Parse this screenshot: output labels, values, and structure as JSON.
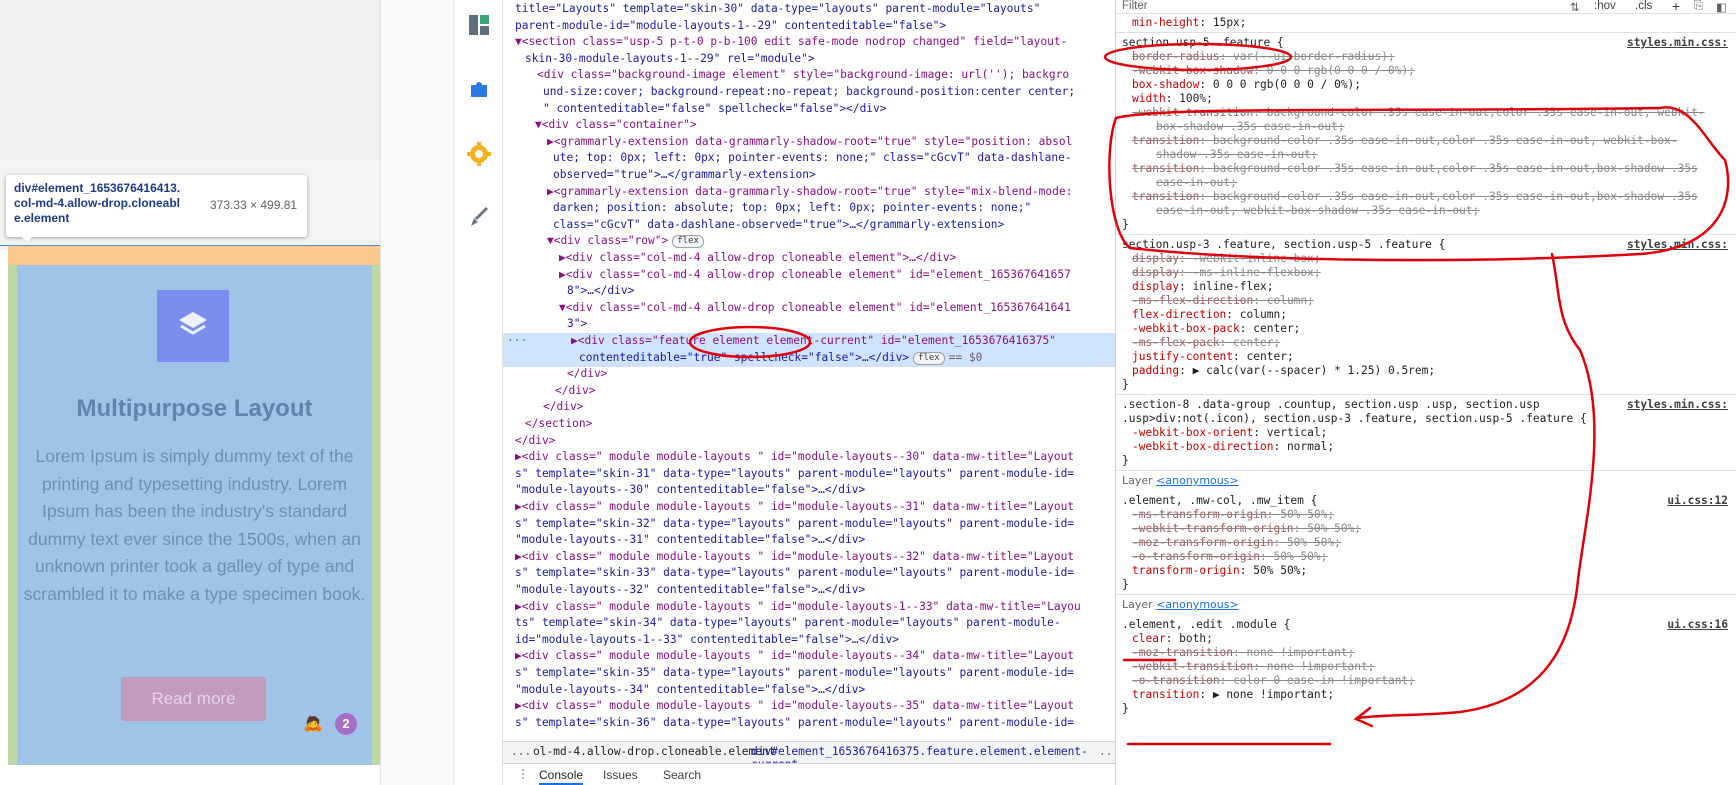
{
  "tooltip": {
    "selector": "div#element_1653676416413.",
    "classes_line1": "col-md-4.allow-drop.cloneabl",
    "classes_line2": "e.element",
    "size": "373.33 × 499.81"
  },
  "feature_card": {
    "title": "Multipurpose Layout",
    "body": "Lorem Ipsum is simply dummy text of the printing and typesetting industry. Lorem Ipsum has been the industry's standard dummy text ever since the 1500s, when an unknown printer took a galley of type and scrambled it to make a type specimen book.",
    "button": "Read more",
    "notif_count": "2"
  },
  "sidebar_icons": [
    "layout-icon",
    "puzzle-icon",
    "settings-gear-icon",
    "brush-icon"
  ],
  "dom_lines": [
    {
      "t": "title=\"Layouts\" template=\"skin-30\" data-type=\"layouts\" parent-module=\"layouts\""
    },
    {
      "t": "parent-module-id=\"module-layouts-1--29\" contenteditable=\"false\">"
    },
    {
      "t": "▼<section class=\"usp-5 p-t-0 p-b-100 edit safe-mode nodrop changed\" field=\"layout-"
    },
    {
      "t": "skin-30-module-layouts-1--29\" rel=\"module\">"
    },
    {
      "t": "<div class=\"background-image element\" style=\"background-image: url(''); backgro"
    },
    {
      "t": "und-size:cover; background-repeat:no-repeat; background-position:center center;"
    },
    {
      "t": "\" contenteditable=\"false\" spellcheck=\"false\"></div>"
    },
    {
      "t": "▼<div class=\"container\">"
    },
    {
      "t": "▶<grammarly-extension data-grammarly-shadow-root=\"true\" style=\"position: absol"
    },
    {
      "t": "ute; top: 0px; left: 0px; pointer-events: none;\" class=\"cGcvT\" data-dashlane-"
    },
    {
      "t": "observed=\"true\">…</grammarly-extension>"
    },
    {
      "t": "▶<grammarly-extension data-grammarly-shadow-root=\"true\" style=\"mix-blend-mode:"
    },
    {
      "t": "darken; position: absolute; top: 0px; left: 0px; pointer-events: none;\""
    },
    {
      "t": "class=\"cGcvT\" data-dashlane-observed=\"true\">…</grammarly-extension>"
    },
    {
      "t": "▼<div class=\"row\">",
      "badge": "flex"
    },
    {
      "t": "▶<div class=\"col-md-4 allow-drop cloneable element\">…</div>"
    },
    {
      "t": "▶<div class=\"col-md-4 allow-drop cloneable element\" id=\"element_165367641657"
    },
    {
      "t": "8\">…</div>"
    },
    {
      "t": "▼<div class=\"col-md-4 allow-drop cloneable element\" id=\"element_165367641641"
    },
    {
      "t": "3\">"
    },
    {
      "t": "▶<div class=\"feature element element-current\" id=\"element_1653676416375\""
    },
    {
      "t": "contenteditable=\"true\" spellcheck=\"false\">…</div>",
      "badge": "flex",
      "tail": "== $0"
    },
    {
      "t": "</div>"
    },
    {
      "t": "</div>"
    },
    {
      "t": "</div>"
    },
    {
      "t": "</section>"
    },
    {
      "t": "</div>"
    },
    {
      "t": "▶<div class=\" module module-layouts \" id=\"module-layouts--30\" data-mw-title=\"Layout"
    },
    {
      "t": "s\" template=\"skin-31\" data-type=\"layouts\" parent-module=\"layouts\" parent-module-id="
    },
    {
      "t": "\"module-layouts--30\" contenteditable=\"false\">…</div>"
    },
    {
      "t": "▶<div class=\" module module-layouts \" id=\"module-layouts--31\" data-mw-title=\"Layout"
    },
    {
      "t": "s\" template=\"skin-32\" data-type=\"layouts\" parent-module=\"layouts\" parent-module-id="
    },
    {
      "t": "\"module-layouts--31\" contenteditable=\"false\">…</div>"
    },
    {
      "t": "▶<div class=\" module module-layouts \" id=\"module-layouts--32\" data-mw-title=\"Layout"
    },
    {
      "t": "s\" template=\"skin-33\" data-type=\"layouts\" parent-module=\"layouts\" parent-module-id="
    },
    {
      "t": "\"module-layouts--32\" contenteditable=\"false\">…</div>"
    },
    {
      "t": "▶<div class=\" module module-layouts \" id=\"module-layouts-1--33\" data-mw-title=\"Layou"
    },
    {
      "t": "ts\" template=\"skin-34\" data-type=\"layouts\" parent-module=\"layouts\" parent-module-"
    },
    {
      "t": "id=\"module-layouts-1--33\" contenteditable=\"false\">…</div>"
    },
    {
      "t": "▶<div class=\" module module-layouts \" id=\"module-layouts--34\" data-mw-title=\"Layout"
    },
    {
      "t": "s\" template=\"skin-35\" data-type=\"layouts\" parent-module=\"layouts\" parent-module-id="
    },
    {
      "t": "\"module-layouts--34\" contenteditable=\"false\">…</div>"
    },
    {
      "t": "▶<div class=\" module module-layouts \" id=\"module-layouts--35\" data-mw-title=\"Layout"
    },
    {
      "t": "s\" template=\"skin-36\" data-type=\"layouts\" parent-module=\"layouts\" parent-module-id="
    }
  ],
  "breadcrumbs": [
    "...",
    "ol-md-4.allow-drop.cloneable.element",
    "div#element_1653676416375.feature.element.element-current",
    "..."
  ],
  "drawer_tabs": [
    "Console",
    "Issues",
    "Search"
  ],
  "styles": {
    "filter_placeholder": "Filter",
    "toolbar": [
      ":hov",
      ".cls",
      "+"
    ],
    "rules": [
      {
        "selector": "",
        "link": "",
        "props": [
          {
            "n": "min-height",
            "v": "15px;"
          }
        ]
      },
      {
        "selector": "section.usp-5 .feature {",
        "link": "styles.min.css:",
        "props": [
          {
            "n": "border-radius",
            "v": "var(--ui-border-radius);",
            "s": true
          },
          {
            "n": "-webkit-box-shadow",
            "v": "0 0 0 rgb(0 0 0 / 0%);",
            "s": true
          },
          {
            "n": "box-shadow",
            "v": "0 0 0 rgb(0 0 0 / 0%);"
          },
          {
            "n": "width",
            "v": "100%;"
          },
          {
            "n": "-webkit-transition",
            "v": "background-color .35s ease-in-out,color .35s ease-in-out, webkit-",
            "s": true
          },
          {
            "n": "",
            "v": "box-shadow .35s ease-in-out;",
            "s": true,
            "i": true
          },
          {
            "n": "transition",
            "v": "background-color .35s ease-in-out,color .35s ease-in-out, webkit-box-",
            "s": true
          },
          {
            "n": "",
            "v": "shadow .35s ease-in-out;",
            "s": true,
            "i": true
          },
          {
            "n": "transition",
            "v": "background-color .35s ease-in-out,color .35s ease-in-out,box-shadow .35s",
            "s": true
          },
          {
            "n": "",
            "v": "ease-in-out;",
            "s": true,
            "i": true
          },
          {
            "n": "transition",
            "v": "background-color .35s ease-in-out,color .35s ease-in-out,box-shadow .35s",
            "s": true
          },
          {
            "n": "",
            "v": "ease-in-out, webkit-box-shadow .35s ease-in-out;",
            "s": true,
            "i": true
          }
        ]
      },
      {
        "selector": "section.usp-3 .feature, section.usp-5 .feature {",
        "link": "styles.min.css:",
        "props": [
          {
            "n": "display",
            "v": "-webkit-inline-box;",
            "s": true
          },
          {
            "n": "display",
            "v": "-ms-inline-flexbox;",
            "s": true
          },
          {
            "n": "display",
            "v": "inline-flex;"
          },
          {
            "n": "-ms-flex-direction",
            "v": "column;",
            "s": true
          },
          {
            "n": "flex-direction",
            "v": "column;"
          },
          {
            "n": "-webkit-box-pack",
            "v": "center;"
          },
          {
            "n": "-ms-flex-pack",
            "v": "center;",
            "s": true
          },
          {
            "n": "justify-content",
            "v": "center;"
          },
          {
            "n": "padding",
            "v": "▶ calc(var(--spacer) * 1.25) 0.5rem;"
          }
        ]
      },
      {
        "selector": ".section-8 .data-group .countup, section.usp .usp, section.usp .usp>div:not(.icon), section.usp-3 .feature, section.usp-5 .feature {",
        "link": "styles.min.css:",
        "props": [
          {
            "n": "-webkit-box-orient",
            "v": "vertical;"
          },
          {
            "n": "-webkit-box-direction",
            "v": "normal;"
          }
        ]
      },
      {
        "layer": "Layer",
        "layer_link": "<anonymous>",
        "selector": ".element, .mw-col, .mw_item {",
        "link": "ui.css:12",
        "props": [
          {
            "n": "-ms-transform-origin",
            "v": "50% 50%;",
            "s": true
          },
          {
            "n": "-webkit-transform-origin",
            "v": "50% 50%;",
            "s": true
          },
          {
            "n": "-moz-transform-origin",
            "v": "50% 50%;",
            "s": true
          },
          {
            "n": "-o-transform-origin",
            "v": "50% 50%;",
            "s": true
          },
          {
            "n": "transform-origin",
            "v": "50% 50%;"
          }
        ]
      },
      {
        "layer": "Layer",
        "layer_link": "<anonymous>",
        "selector": ".element, .edit .module {",
        "link": "ui.css:16",
        "props": [
          {
            "n": "clear",
            "v": "both;"
          },
          {
            "n": "-moz-transition",
            "v": "none !important;",
            "s": true
          },
          {
            "n": "-webkit-transition",
            "v": "none !important;",
            "s": true
          },
          {
            "n": "-o-transition",
            "v": "color 0 ease-in !important;",
            "s": true
          },
          {
            "n": "transition",
            "v": "▶ none !important;"
          }
        ]
      }
    ]
  },
  "annot_color": "#e0000b"
}
